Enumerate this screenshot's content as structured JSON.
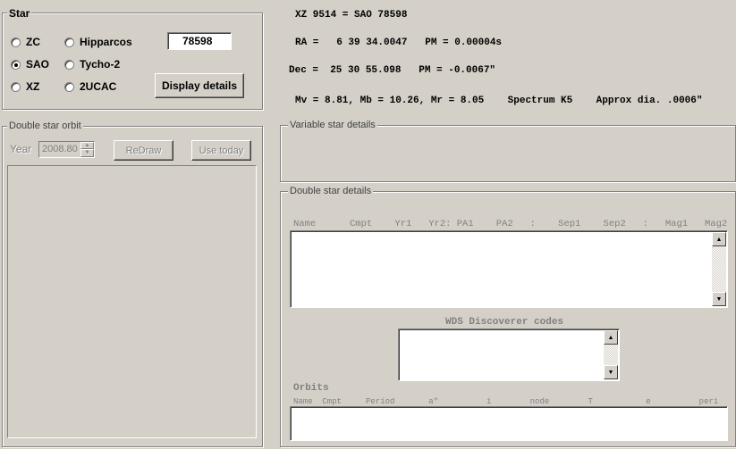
{
  "star_panel": {
    "legend": "Star",
    "radios": [
      {
        "label": "ZC",
        "selected": false
      },
      {
        "label": "SAO",
        "selected": true
      },
      {
        "label": "XZ",
        "selected": false
      },
      {
        "label": "Hipparcos",
        "selected": false
      },
      {
        "label": "Tycho-2",
        "selected": false
      },
      {
        "label": "2UCAC",
        "selected": false
      }
    ],
    "catalog_number": "78598",
    "display_button": "Display details"
  },
  "star_info": {
    "line1": "XZ 9514 = SAO 78598",
    "line2": "RA =   6 39 34.0047   PM = 0.00004s",
    "line3": "Dec =  25 30 55.098   PM = -0.0067\"",
    "line4": "Mv = 8.81, Mb = 10.26, Mr = 8.05    Spectrum K5    Approx dia. .0006\""
  },
  "orbit_panel": {
    "legend": "Double star orbit",
    "year_label": "Year",
    "year_value": "2008.80",
    "redraw_button": "ReDraw",
    "today_button": "Use today"
  },
  "variable_panel": {
    "legend": "Variable star details"
  },
  "double_panel": {
    "legend": "Double star details",
    "header": "Name      Cmpt    Yr1   Yr2: PA1    PA2   :    Sep1    Sep2   :   Mag1   Mag2",
    "wds_label": "WDS Discoverer codes",
    "orbits_label": "Orbits",
    "orbits_header": "Name  Cmpt     Period       a\"          i        node        T           e          peri"
  }
}
